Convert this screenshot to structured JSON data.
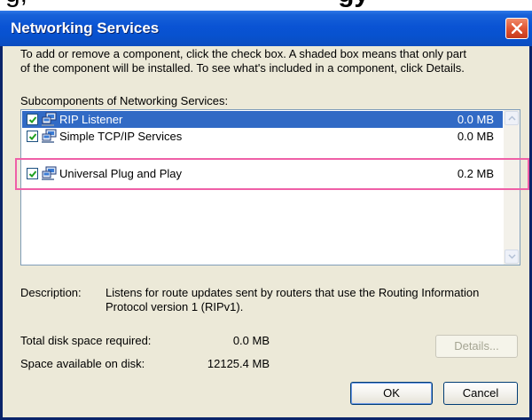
{
  "window": {
    "title": "Networking Services",
    "close_icon": "close-icon"
  },
  "instructions": {
    "line1": "To add or remove a component, click the check box. A shaded box means that only part",
    "line2": "of the component will be installed. To see what's included in a component, click Details."
  },
  "subcomponents": {
    "label": "Subcomponents of Networking Services:",
    "items": [
      {
        "label": "RIP Listener",
        "size": "0.0 MB",
        "checked": true,
        "selected": true
      },
      {
        "label": "Simple TCP/IP Services",
        "size": "0.0 MB",
        "checked": true,
        "selected": false
      },
      {
        "label": "Universal Plug and Play",
        "size": "0.2 MB",
        "checked": true,
        "selected": false
      }
    ]
  },
  "description": {
    "label": "Description:",
    "line1": "Listens for route updates sent by routers that use the Routing Information",
    "line2": "Protocol version 1 (RIPv1)."
  },
  "disk": {
    "required_label": "Total disk space required:",
    "required_value": "0.0 MB",
    "available_label": "Space available on disk:",
    "available_value": "12125.4 MB"
  },
  "buttons": {
    "details": "Details...",
    "ok": "OK",
    "cancel": "Cancel"
  },
  "colors": {
    "title_bar": "#0a53d4",
    "dialog_bg": "#ece9d8",
    "selection": "#316ac5",
    "annotation_highlight": "#ef5fa7"
  }
}
